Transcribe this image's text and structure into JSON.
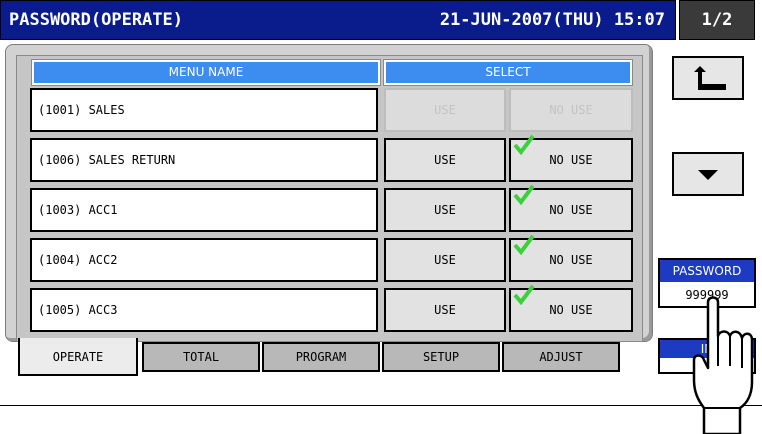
{
  "header": {
    "title": "PASSWORD(OPERATE)",
    "datetime": "21-JUN-2007(THU) 15:07",
    "page": "1/2"
  },
  "columns": {
    "menu_name": "MENU NAME",
    "select": "SELECT"
  },
  "rows": [
    {
      "name": "(1001) SALES",
      "use": "USE",
      "no_use": "NO USE",
      "enabled": false,
      "checked": false
    },
    {
      "name": "(1006) SALES RETURN",
      "use": "USE",
      "no_use": "NO USE",
      "enabled": true,
      "checked": true
    },
    {
      "name": "(1003) ACC1",
      "use": "USE",
      "no_use": "NO USE",
      "enabled": true,
      "checked": true
    },
    {
      "name": "(1004) ACC2",
      "use": "USE",
      "no_use": "NO USE",
      "enabled": true,
      "checked": true
    },
    {
      "name": "(1005) ACC3",
      "use": "USE",
      "no_use": "NO USE",
      "enabled": true,
      "checked": true
    }
  ],
  "side": {
    "back_icon": "back-arrow-icon",
    "down_icon": "down-arrow-icon"
  },
  "password": {
    "label": "PASSWORD",
    "value": "999999"
  },
  "tabs": [
    {
      "label": "OPERATE",
      "active": true
    },
    {
      "label": "TOTAL",
      "active": false
    },
    {
      "label": "PROGRAM",
      "active": false
    },
    {
      "label": "SETUP",
      "active": false
    },
    {
      "label": "ADJUST",
      "active": false
    }
  ],
  "in_badge": {
    "label": "IN"
  },
  "colors": {
    "header_bg": "#0a1c8c",
    "column_header": "#3d8cf0",
    "check": "#3cd13c"
  }
}
